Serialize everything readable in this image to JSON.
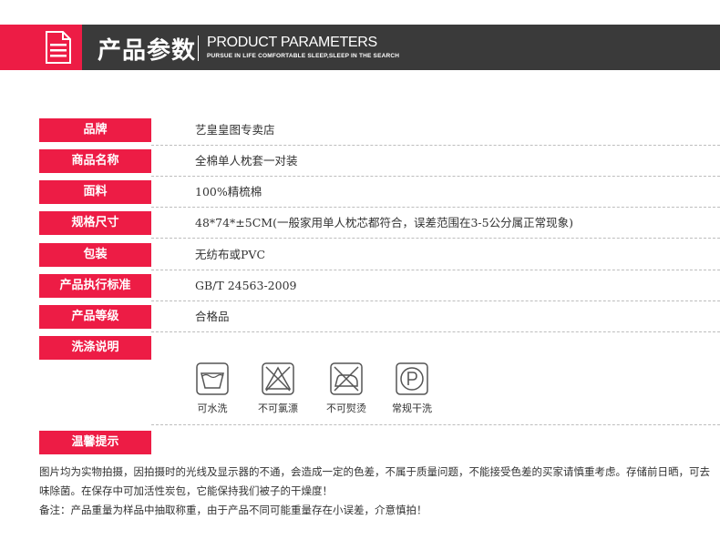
{
  "header": {
    "title_cn": "产品参数",
    "title_en": "PRODUCT PARAMETERS",
    "subtitle_en": "PURSUE IN LIFE COMFORTABLE SLEEP,SLEEP IN THE SEARCH",
    "icon": "document-icon",
    "colors": {
      "accent": "#ed1c45",
      "dark": "#3a3a3a"
    }
  },
  "params": [
    {
      "label": "品牌",
      "value": "艺皇皇图专卖店"
    },
    {
      "label": "商品名称",
      "value": "全棉单人枕套一对装"
    },
    {
      "label": "面料",
      "value": "100%精梳棉"
    },
    {
      "label": "规格尺寸",
      "value": "48*74*±5CM(一般家用单人枕芯都符合，误差范围在3-5公分属正常现象)"
    },
    {
      "label": "包装",
      "value": "无纺布或PVC"
    },
    {
      "label": "产品执行标准",
      "value": "GB/T 24563-2009"
    },
    {
      "label": "产品等级",
      "value": "合格品"
    }
  ],
  "wash": {
    "label": "洗涤说明",
    "items": [
      {
        "icon": "machine-wash-icon",
        "caption": "可水洗"
      },
      {
        "icon": "no-bleach-icon",
        "caption": "不可氯漂"
      },
      {
        "icon": "no-iron-icon",
        "caption": "不可熨烫"
      },
      {
        "icon": "dry-clean-p-icon",
        "caption": "常规干洗"
      }
    ]
  },
  "tips": {
    "label": "温馨提示",
    "line1": "图片均为实物拍摄，因拍摄时的光线及显示器的不通，会造成一定的色差，不属于质量问题，不能接受色差的买家请慎重考虑。存储前日晒，可去味除菌。在保存中可加活性炭包，它能保持我们被子的干燥度！",
    "line2": "备注：产品重量为样品中抽取称重，由于产品不同可能重量存在小误差，介意慎拍！"
  }
}
